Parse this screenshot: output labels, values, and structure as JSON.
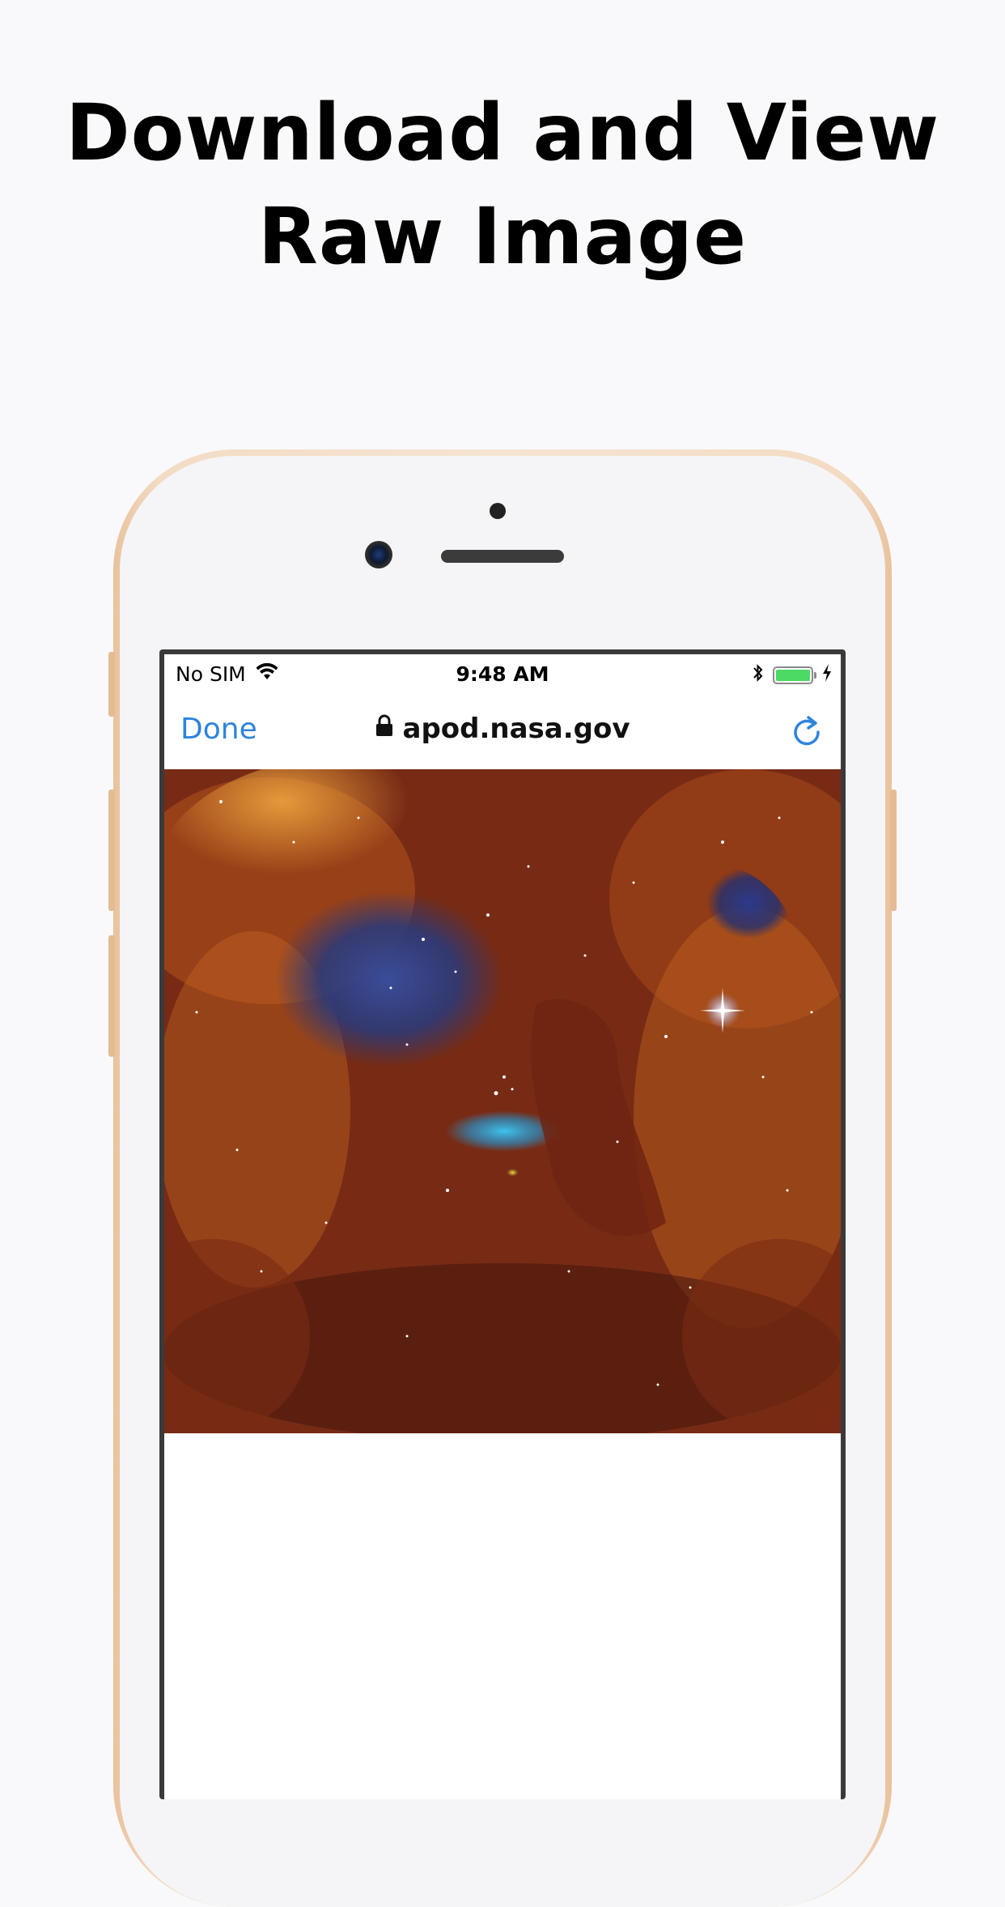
{
  "headline": {
    "line1": "Download and View",
    "line2": "Raw Image"
  },
  "status_bar": {
    "carrier": "No SIM",
    "time": "9:48 AM",
    "wifi_icon": "wifi-icon",
    "bluetooth_icon": "bluetooth-icon",
    "battery_level": 1.0,
    "charging_icon": "charging-bolt-icon"
  },
  "browser": {
    "done_label": "Done",
    "url": "apod.nasa.gov",
    "lock_icon": "lock-icon",
    "reload_icon": "reload-icon"
  },
  "content": {
    "image": "nebula-photo"
  },
  "colors": {
    "accent": "#2e84dc",
    "phone_frame": "#e9c29d",
    "battery": "#4cd964"
  }
}
